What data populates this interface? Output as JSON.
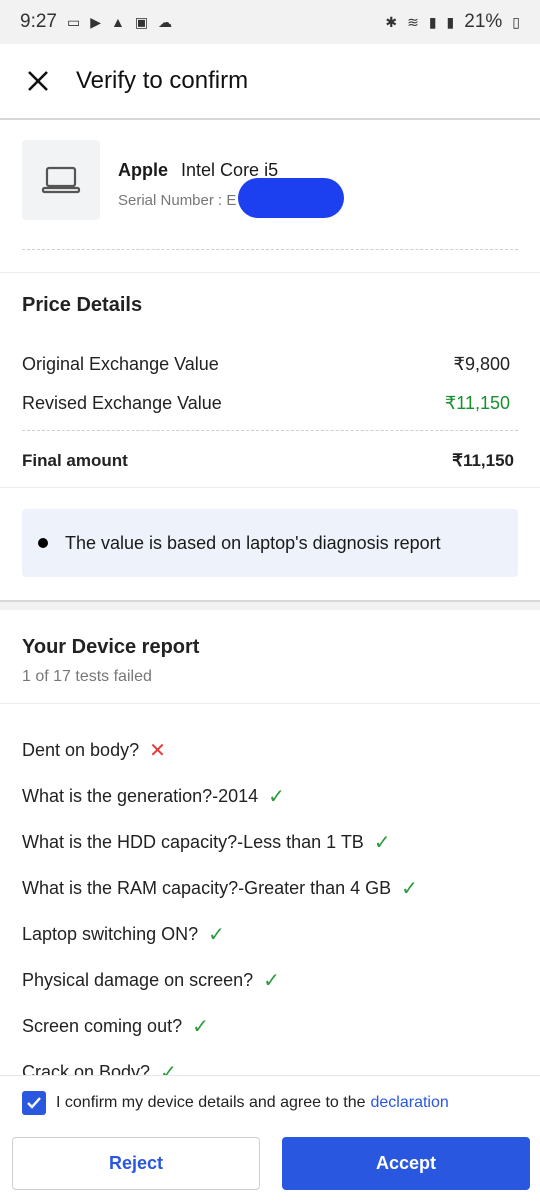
{
  "status_bar": {
    "time": "9:27",
    "battery": "21%"
  },
  "header": {
    "title": "Verify to confirm"
  },
  "device": {
    "brand": "Apple",
    "model": "Intel Core i5",
    "serial_label": "Serial Number : E"
  },
  "price_details": {
    "title": "Price Details",
    "rows": [
      {
        "label": "Original Exchange Value",
        "value": "₹9,800"
      },
      {
        "label": "Revised Exchange Value",
        "value": "₹11,150"
      }
    ],
    "final_label": "Final amount",
    "final_value": "₹11,150",
    "note": "The value is based on laptop's diagnosis report"
  },
  "report": {
    "title": "Your Device report",
    "subtitle": "1 of 17 tests failed",
    "items": [
      {
        "text": "Dent on body?",
        "status": "fail"
      },
      {
        "text": "What is the generation?-2014",
        "status": "pass"
      },
      {
        "text": "What is the HDD capacity?-Less than 1 TB",
        "status": "pass"
      },
      {
        "text": "What is the RAM capacity?-Greater than 4 GB",
        "status": "pass"
      },
      {
        "text": "Laptop switching ON?",
        "status": "pass"
      },
      {
        "text": "Physical damage on screen?",
        "status": "pass"
      },
      {
        "text": "Screen coming out?",
        "status": "pass"
      },
      {
        "text": "Crack on Body?",
        "status": "pass"
      }
    ]
  },
  "footer": {
    "consent_text": "I confirm my device details and agree to the",
    "consent_link": "declaration",
    "checked": true,
    "reject_label": "Reject",
    "accept_label": "Accept"
  },
  "colors": {
    "primary": "#2a57e0",
    "success": "#1a8f2e",
    "error": "#e53935"
  }
}
